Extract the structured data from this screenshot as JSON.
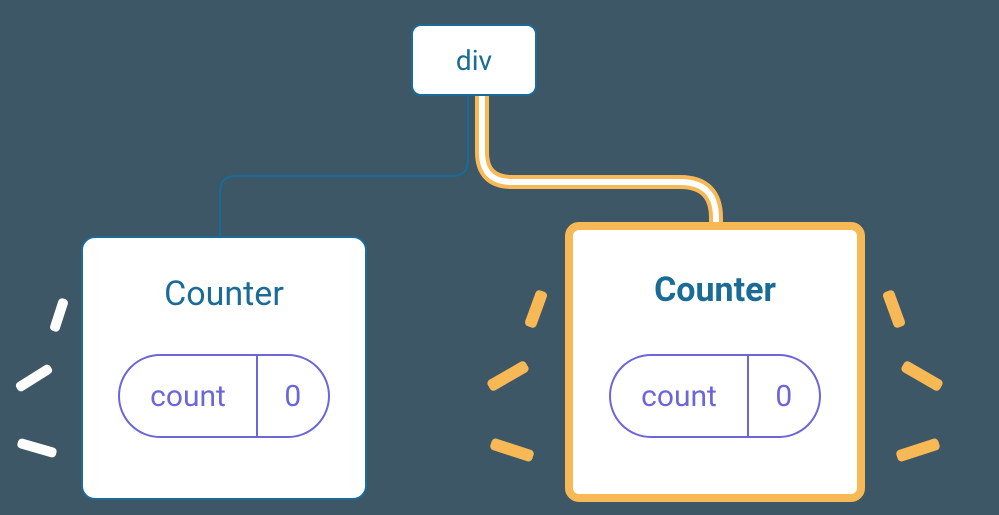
{
  "tree": {
    "root": {
      "label": "div"
    },
    "left": {
      "title": "Counter",
      "pill_label": "count",
      "pill_value": "0",
      "highlighted": false
    },
    "right": {
      "title": "Counter",
      "pill_label": "count",
      "pill_value": "0",
      "highlighted": true
    }
  },
  "colors": {
    "background": "#3e5766",
    "blue": "#1a6b95",
    "purple": "#6b66d9",
    "highlight": "#f7b955",
    "white": "#ffffff"
  }
}
